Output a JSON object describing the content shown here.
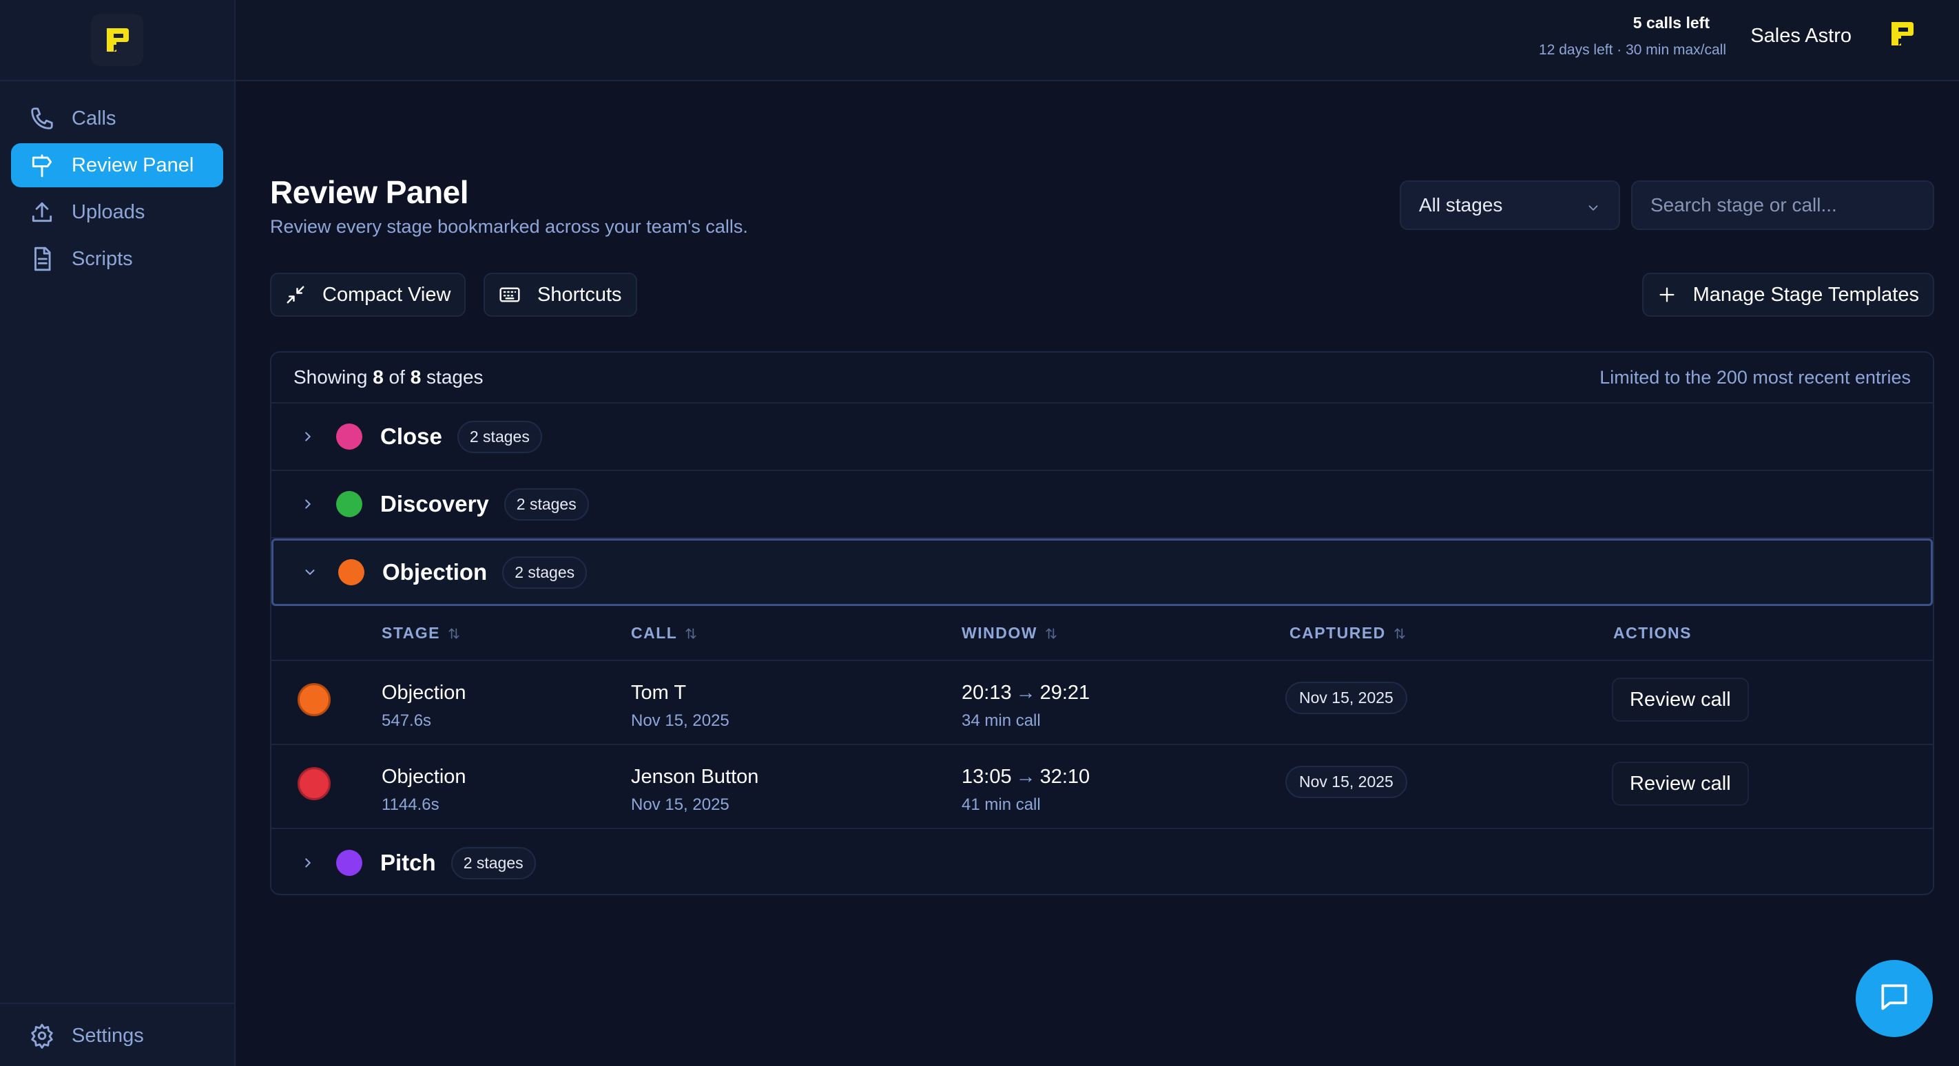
{
  "sidebar": {
    "items": [
      {
        "label": "Calls",
        "icon": "phone-icon"
      },
      {
        "label": "Review Panel",
        "icon": "signpost-icon",
        "active": true
      },
      {
        "label": "Uploads",
        "icon": "upload-icon"
      },
      {
        "label": "Scripts",
        "icon": "document-icon"
      }
    ],
    "settings_label": "Settings"
  },
  "header": {
    "calls_left": "5 calls left",
    "plan_info": "12 days left · 30 min max/call",
    "user_name": "Sales Astro"
  },
  "page": {
    "title": "Review Panel",
    "subtitle": "Review every stage bookmarked across your team's calls."
  },
  "filters": {
    "stage_select": "All stages",
    "search_placeholder": "Search stage or call..."
  },
  "toolbar": {
    "compact_view": "Compact View",
    "shortcuts": "Shortcuts",
    "manage_templates": "Manage Stage Templates"
  },
  "summary": {
    "showing": "Showing",
    "shown": "8",
    "of": "of",
    "total": "8",
    "unit": "stages",
    "limit_note": "Limited to the 200 most recent entries"
  },
  "groups": [
    {
      "name": "Close",
      "count": "2 stages",
      "color": "#e23a8c",
      "expanded": false
    },
    {
      "name": "Discovery",
      "count": "2 stages",
      "color": "#2fb344",
      "expanded": false
    },
    {
      "name": "Objection",
      "count": "2 stages",
      "color": "#f26b1d",
      "expanded": true
    },
    {
      "name": "Pitch",
      "count": "2 stages",
      "color": "#8b3bf2",
      "expanded": false
    }
  ],
  "table": {
    "headers": [
      "STAGE",
      "CALL",
      "WINDOW",
      "CAPTURED",
      "ACTIONS"
    ],
    "rows": [
      {
        "color": "#f26b1d",
        "stage": "Objection",
        "duration": "547.6s",
        "caller": "Tom T",
        "call_date": "Nov 15, 2025",
        "start": "20:13",
        "end": "29:21",
        "call_length": "34 min call",
        "captured": "Nov 15, 2025",
        "action": "Review call"
      },
      {
        "color": "#e5323f",
        "stage": "Objection",
        "duration": "1144.6s",
        "caller": "Jenson Button",
        "call_date": "Nov 15, 2025",
        "start": "13:05",
        "end": "32:10",
        "call_length": "41 min call",
        "captured": "Nov 15, 2025",
        "action": "Review call"
      }
    ]
  },
  "colors": {
    "accent": "#1aa3f0",
    "brand_yellow": "#f5e10f"
  }
}
